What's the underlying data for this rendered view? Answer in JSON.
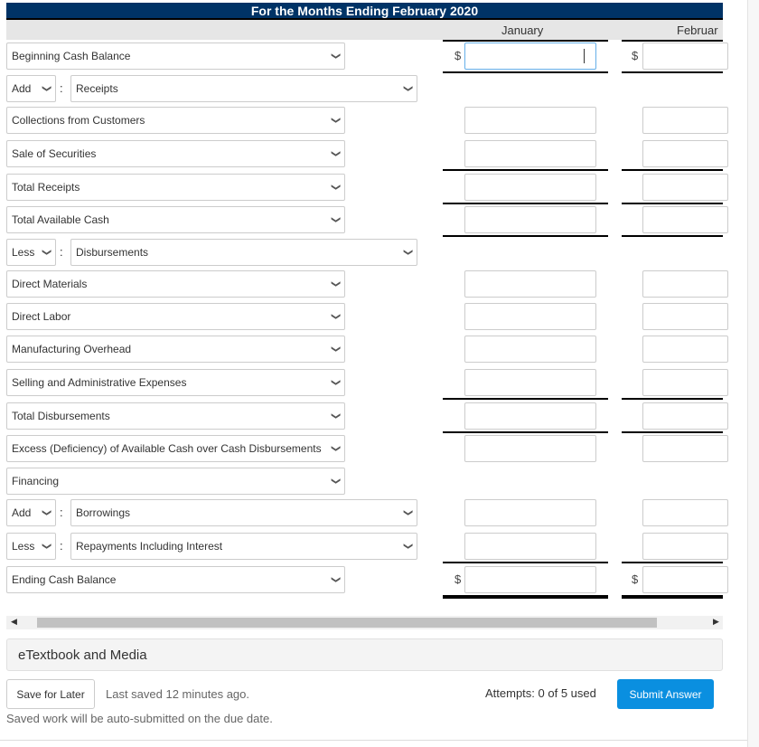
{
  "title": "For the Months Ending February 2020",
  "columns": [
    "January",
    "Februar"
  ],
  "currency": "$",
  "rows": [
    {
      "type": "select",
      "label": "Beginning Cash Balance",
      "inputs": true,
      "dollar": true,
      "focused": true
    },
    {
      "type": "op",
      "op": "Add",
      "label": "Receipts",
      "inputs": false
    },
    {
      "type": "select",
      "label": "Collections from Customers",
      "inputs": true
    },
    {
      "type": "select",
      "label": "Sale of Securities",
      "inputs": true
    },
    {
      "type": "select",
      "label": "Total Receipts",
      "inputs": true
    },
    {
      "type": "select",
      "label": "Total Available Cash",
      "inputs": true
    },
    {
      "type": "op",
      "op": "Less",
      "label": "Disbursements",
      "inputs": false
    },
    {
      "type": "select",
      "label": "Direct Materials",
      "inputs": true
    },
    {
      "type": "select",
      "label": "Direct Labor",
      "inputs": true
    },
    {
      "type": "select",
      "label": "Manufacturing Overhead",
      "inputs": true
    },
    {
      "type": "select",
      "label": "Selling and Administrative Expenses",
      "inputs": true
    },
    {
      "type": "select",
      "label": "Total Disbursements",
      "inputs": true
    },
    {
      "type": "select",
      "label": "Excess (Deficiency) of Available Cash over Cash Disbursements",
      "inputs": true
    },
    {
      "type": "select",
      "label": "Financing",
      "inputs": false
    },
    {
      "type": "op",
      "op": "Add",
      "label": "Borrowings",
      "inputs": true
    },
    {
      "type": "op",
      "op": "Less",
      "label": "Repayments Including Interest",
      "inputs": true
    },
    {
      "type": "select",
      "label": "Ending Cash Balance",
      "inputs": true,
      "dollar": true
    }
  ],
  "etextbook": "eTextbook and Media",
  "footer": {
    "save_label": "Save for Later",
    "last_saved": "Last saved 12 minutes ago.",
    "auto_submit": "Saved work will be auto-submitted on the due date.",
    "attempts": "Attempts: 0 of 5 used",
    "submit_label": "Submit Answer"
  },
  "colors": {
    "header": "#003366",
    "submit": "#0a8fe0"
  }
}
